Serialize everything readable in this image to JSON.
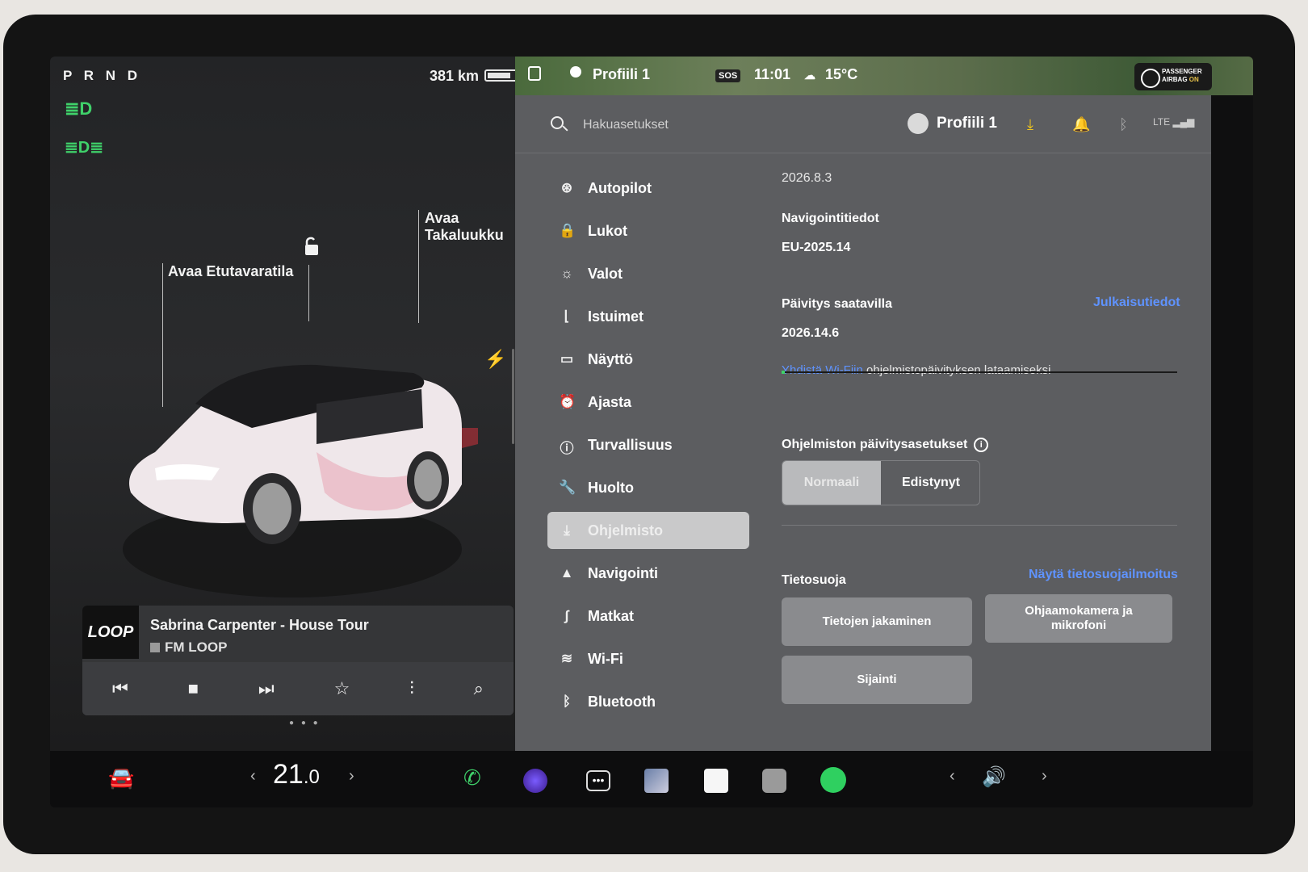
{
  "status": {
    "gear": "P R N D",
    "range": "381 km",
    "map_profile": "Profiili 1",
    "sos": "SOS",
    "time": "11:01",
    "temperature": "15°C",
    "airbag_line1": "PASSENGER",
    "airbag_line2": "AIRBAG",
    "airbag_state": "ON"
  },
  "car": {
    "frunk_label": "Avaa Etutavaratila",
    "trunk_label": "Avaa Takaluukku"
  },
  "media": {
    "art_text": "LOOP",
    "title": "Sabrina Carpenter - House Tour",
    "station": "FM LOOP"
  },
  "topbar": {
    "search_placeholder": "Hakuasetukset",
    "profile_name": "Profiili 1"
  },
  "menu": [
    {
      "label": "Autopilot",
      "icon": "steering-wheel-icon"
    },
    {
      "label": "Lukot",
      "icon": "lock-icon"
    },
    {
      "label": "Valot",
      "icon": "sun-icon"
    },
    {
      "label": "Istuimet",
      "icon": "seat-icon"
    },
    {
      "label": "Näyttö",
      "icon": "display-icon"
    },
    {
      "label": "Ajasta",
      "icon": "alarm-clock-icon"
    },
    {
      "label": "Turvallisuus",
      "icon": "alert-circle-icon"
    },
    {
      "label": "Huolto",
      "icon": "wrench-icon"
    },
    {
      "label": "Ohjelmisto",
      "icon": "download-icon",
      "active": true
    },
    {
      "label": "Navigointi",
      "icon": "navigation-arrow-icon"
    },
    {
      "label": "Matkat",
      "icon": "trips-icon"
    },
    {
      "label": "Wi-Fi",
      "icon": "wifi-icon"
    },
    {
      "label": "Bluetooth",
      "icon": "bluetooth-icon"
    }
  ],
  "software": {
    "version": "2026.8.3",
    "nav_title": "Navigointitiedot",
    "nav_version": "EU-2025.14",
    "update_title": "Päivitys saatavilla",
    "release_notes": "Julkaisutiedot",
    "update_version": "2026.14.6",
    "wifi_link": "Yhdistä Wi-Fiin",
    "wifi_text": "ohjelmistopäivityksen lataamiseksi",
    "download_progress": 0.01,
    "prefs_title": "Ohjelmiston päivitysasetukset",
    "opt_normal": "Normaali",
    "opt_advanced": "Edistynyt",
    "privacy_title": "Tietosuoja",
    "privacy_link": "Näytä tietosuojailmoitus",
    "btn_data_sharing": "Tietojen jakaminen",
    "btn_cabin_camera": "Ohjaamokamera ja mikrofoni",
    "btn_location": "Sijainti"
  },
  "dock": {
    "temp_int": "21",
    "temp_dec": ".0"
  },
  "colors": {
    "accent_green": "#3fd16a",
    "link_blue": "#5f93ff",
    "download_yellow": "#f3c81b"
  }
}
